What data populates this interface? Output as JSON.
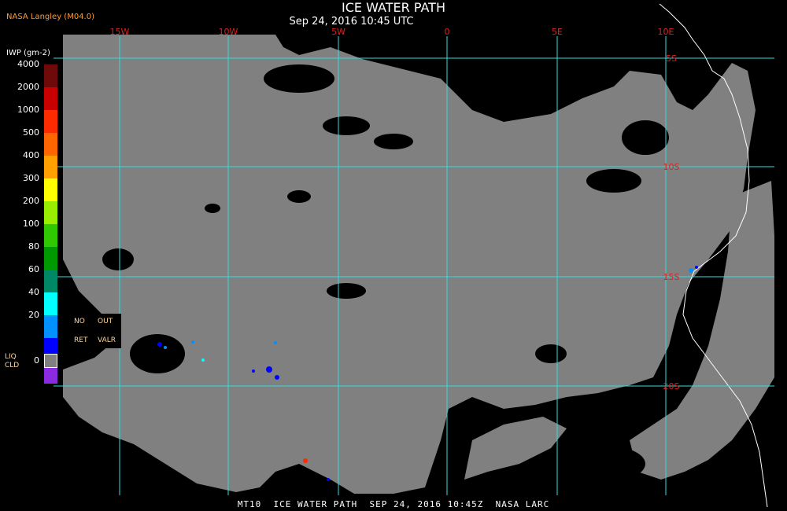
{
  "header": {
    "title": "ICE WATER PATH",
    "subtitle": "Sep 24, 2016 10:45 UTC",
    "source": "NASA Langley (M04.0)"
  },
  "legend": {
    "unit": "IWP (gm-2)",
    "items": [
      {
        "label": "4000",
        "color": "#6e0a0a"
      },
      {
        "label": "2000",
        "color": "#c80000"
      },
      {
        "label": "1000",
        "color": "#ff2b00"
      },
      {
        "label": "500",
        "color": "#ff6600"
      },
      {
        "label": "400",
        "color": "#ffa000"
      },
      {
        "label": "300",
        "color": "#ffff00"
      },
      {
        "label": "200",
        "color": "#99ee00"
      },
      {
        "label": "100",
        "color": "#30c800"
      },
      {
        "label": "80",
        "color": "#009900"
      },
      {
        "label": "60",
        "color": "#008866"
      },
      {
        "label": "40",
        "color": "#00ffff"
      },
      {
        "label": "20",
        "color": "#0090ff"
      },
      {
        "label": "",
        "color": "#0000ff"
      },
      {
        "label": "0",
        "color": "#8a2be2"
      }
    ],
    "no_ret": {
      "line1a": "NO",
      "line1b": "OUT",
      "line2a": "RET",
      "line2b": "VALR"
    },
    "liq": {
      "line1": "LIQ",
      "line2": "CLD",
      "color": "#808080"
    }
  },
  "map": {
    "lon_labels": [
      "15W",
      "10W",
      "5W",
      "0",
      "5E",
      "10E"
    ],
    "lat_labels": [
      "5S",
      "10S",
      "15S",
      "20S"
    ],
    "grid_color": "#33dddd",
    "label_color": "#dd2222",
    "land_color": "#808080",
    "ocean_color": "#000000"
  },
  "footer": "MT10  ICE WATER PATH  SEP 24, 2016 10:45Z  NASA LARC"
}
